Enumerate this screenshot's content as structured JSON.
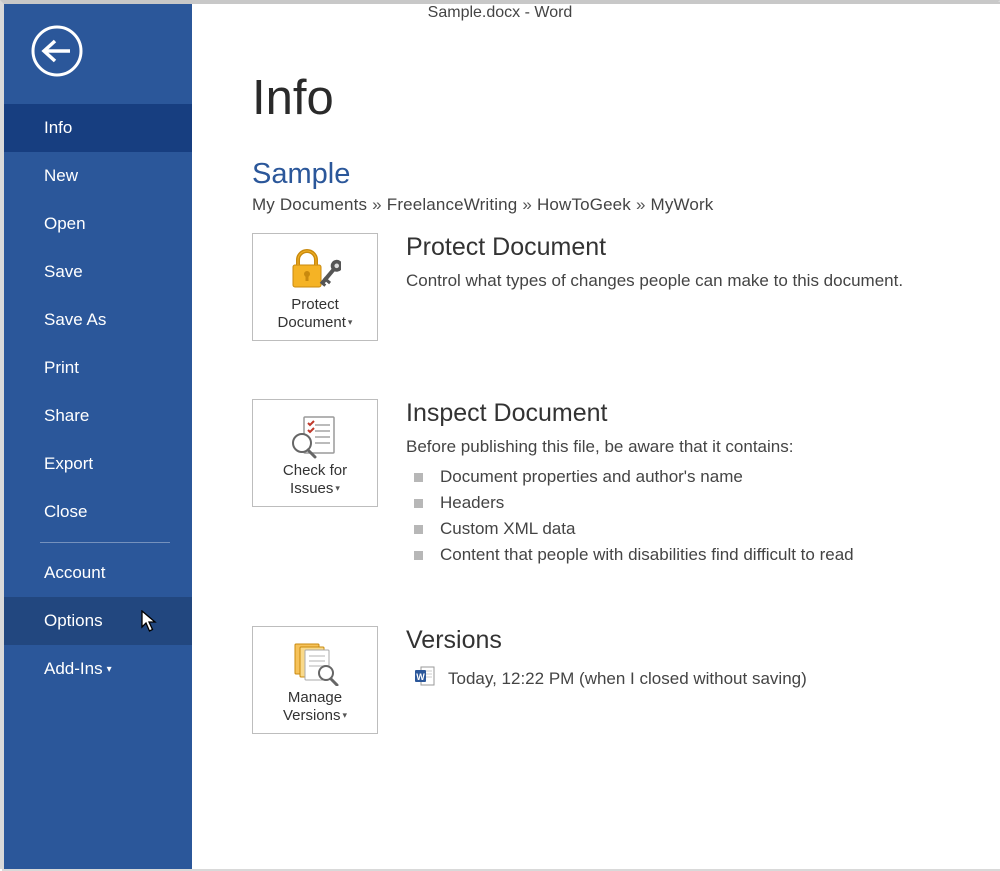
{
  "titlebar": {
    "text": "Sample.docx - Word"
  },
  "sidebar": {
    "items": [
      {
        "label": "Info",
        "active": true
      },
      {
        "label": "New",
        "active": false
      },
      {
        "label": "Open",
        "active": false
      },
      {
        "label": "Save",
        "active": false
      },
      {
        "label": "Save As",
        "active": false
      },
      {
        "label": "Print",
        "active": false
      },
      {
        "label": "Share",
        "active": false
      },
      {
        "label": "Export",
        "active": false
      },
      {
        "label": "Close",
        "active": false
      }
    ],
    "accountLabel": "Account",
    "optionsLabel": "Options",
    "addinsLabel": "Add-Ins"
  },
  "main": {
    "pageTitle": "Info",
    "documentName": "Sample",
    "breadcrumb": [
      "My Documents",
      "FreelanceWriting",
      "HowToGeek",
      "MyWork"
    ],
    "protect": {
      "tileLine1": "Protect",
      "tileLine2": "Document",
      "heading": "Protect Document",
      "description": "Control what types of changes people can make to this document."
    },
    "inspect": {
      "tileLine1": "Check for",
      "tileLine2": "Issues",
      "heading": "Inspect Document",
      "intro": "Before publishing this file, be aware that it contains:",
      "items": [
        "Document properties and author's name",
        "Headers",
        "Custom XML data",
        "Content that people with disabilities find difficult to read"
      ]
    },
    "versions": {
      "tileLine1": "Manage",
      "tileLine2": "Versions",
      "heading": "Versions",
      "entry": "Today, 12:22 PM (when I closed without saving)"
    }
  }
}
